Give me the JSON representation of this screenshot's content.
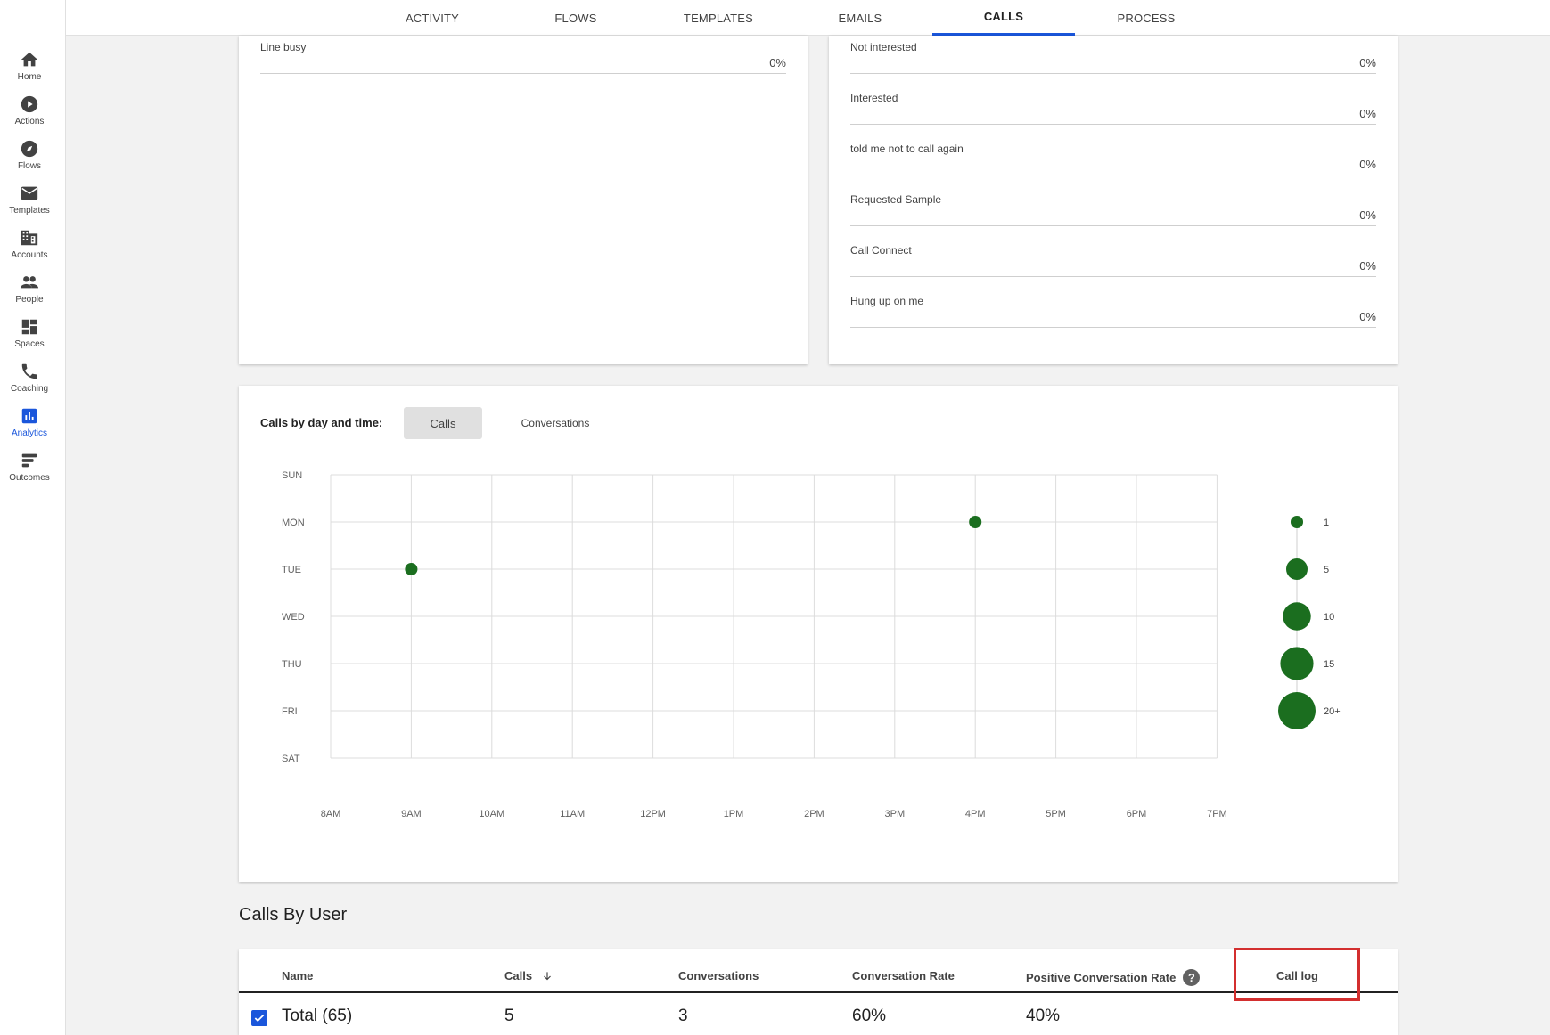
{
  "nav": [
    {
      "label": "Home",
      "icon": "home-icon"
    },
    {
      "label": "Actions",
      "icon": "play-circle-icon"
    },
    {
      "label": "Flows",
      "icon": "compass-icon"
    },
    {
      "label": "Templates",
      "icon": "mail-icon"
    },
    {
      "label": "Accounts",
      "icon": "building-icon"
    },
    {
      "label": "People",
      "icon": "people-icon"
    },
    {
      "label": "Spaces",
      "icon": "dashboard-icon"
    },
    {
      "label": "Coaching",
      "icon": "phone-icon"
    },
    {
      "label": "Analytics",
      "icon": "bar-chart-icon",
      "active": true
    },
    {
      "label": "Outcomes",
      "icon": "outcomes-icon"
    }
  ],
  "tabs": [
    {
      "label": "ACTIVITY"
    },
    {
      "label": "FLOWS"
    },
    {
      "label": "TEMPLATES"
    },
    {
      "label": "EMAILS"
    },
    {
      "label": "CALLS",
      "active": true
    },
    {
      "label": "PROCESS"
    }
  ],
  "left_card": {
    "rows": [
      {
        "label": "Line busy",
        "value": "0%"
      }
    ]
  },
  "right_card": {
    "rows": [
      {
        "label": "Not interested",
        "value": "0%"
      },
      {
        "label": "Interested",
        "value": "0%"
      },
      {
        "label": "told me not to call again",
        "value": "0%"
      },
      {
        "label": "Requested Sample",
        "value": "0%"
      },
      {
        "label": "Call Connect",
        "value": "0%"
      },
      {
        "label": "Hung up on me",
        "value": "0%"
      }
    ]
  },
  "heatmap": {
    "title": "Calls by day and time:",
    "toggle_calls": "Calls",
    "toggle_conversations": "Conversations"
  },
  "chart_data": {
    "type": "scatter",
    "title": "Calls by day and time:",
    "days": [
      "SUN",
      "MON",
      "TUE",
      "WED",
      "THU",
      "FRI",
      "SAT"
    ],
    "hours": [
      "8AM",
      "9AM",
      "10AM",
      "11AM",
      "12PM",
      "1PM",
      "2PM",
      "3PM",
      "4PM",
      "5PM",
      "6PM",
      "7PM"
    ],
    "points": [
      {
        "day": "TUE",
        "hour": "9AM",
        "value": 1
      },
      {
        "day": "MON",
        "hour": "4PM",
        "value": 1
      }
    ],
    "legend": [
      {
        "label": "1",
        "value": 1
      },
      {
        "label": "5",
        "value": 5
      },
      {
        "label": "10",
        "value": 10
      },
      {
        "label": "15",
        "value": 15
      },
      {
        "label": "20+",
        "value": 20
      }
    ],
    "color": "#1b6e1f",
    "grid": true,
    "legend_position": "right"
  },
  "calls_by_user": {
    "title": "Calls By User",
    "columns": [
      "Name",
      "Calls",
      "Conversations",
      "Conversation Rate",
      "Positive Conversation Rate",
      "Call log"
    ],
    "total_row": {
      "name": "Total (65)",
      "calls": "5",
      "conversations": "3",
      "conversation_rate": "60%",
      "positive_rate": "40%"
    }
  },
  "colors": {
    "accent": "#1a56db",
    "dot": "#1b6e1f",
    "highlight": "#d32f2f"
  }
}
